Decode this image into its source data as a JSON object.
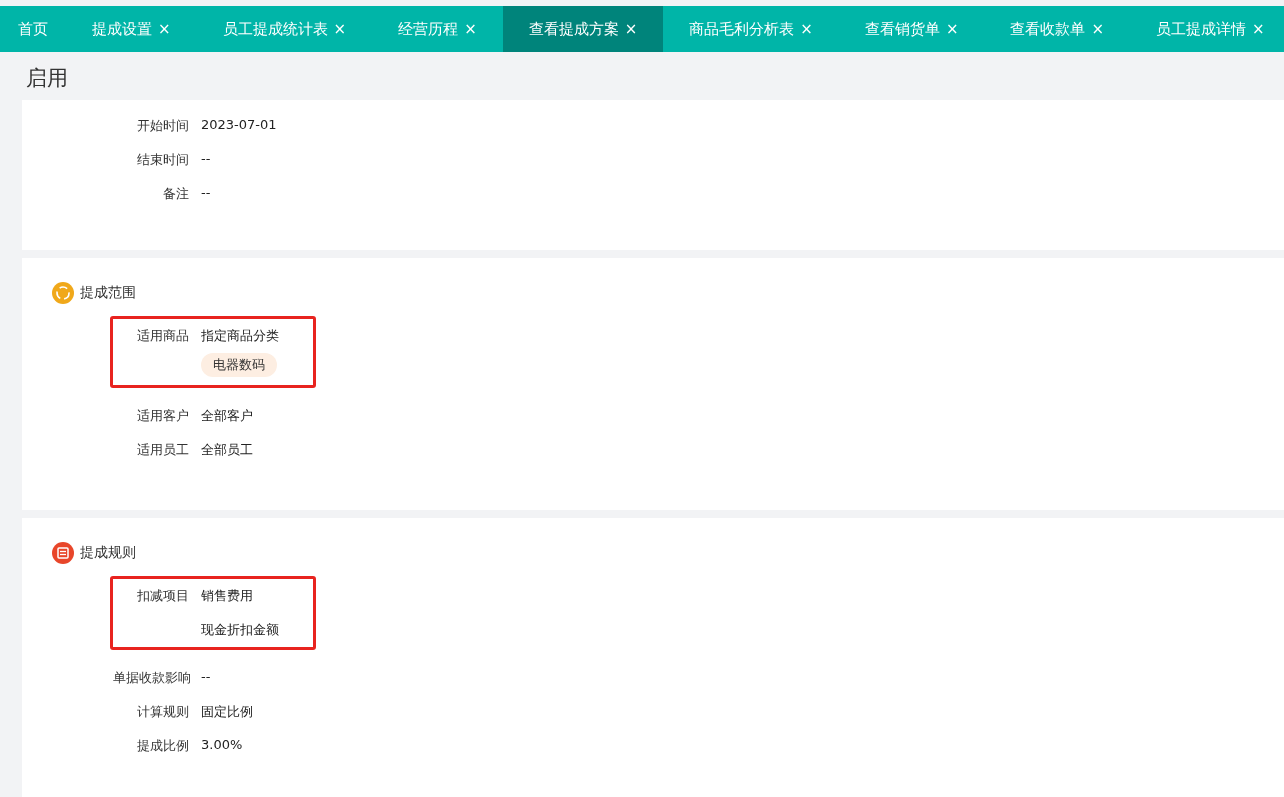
{
  "tabs": [
    {
      "label": "首页",
      "selected": false
    },
    {
      "label": "提成设置",
      "close": "×",
      "selected": false
    },
    {
      "label": "员工提成统计表",
      "close": "×",
      "selected": false
    },
    {
      "label": "经营历程",
      "close": "×",
      "selected": false
    },
    {
      "label": "查看提成方案",
      "close": "×",
      "selected": true
    },
    {
      "label": "商品毛利分析表",
      "close": "×",
      "selected": false
    },
    {
      "label": "查看销货单",
      "close": "×",
      "selected": false
    },
    {
      "label": "查看收款单",
      "close": "×",
      "selected": false
    },
    {
      "label": "员工提成详情",
      "close": "×",
      "selected": false
    }
  ],
  "status": "启用",
  "sections": [
    {
      "groups": [
        {
          "highlighted": false,
          "fields": [
            {
              "label": "开始时间",
              "values": [
                {
                  "kind": "text",
                  "text": "2023-07-01"
                }
              ]
            },
            {
              "label": "结束时间",
              "values": [
                {
                  "kind": "text",
                  "text": "--"
                }
              ]
            },
            {
              "label": "备注",
              "values": [
                {
                  "kind": "text",
                  "text": "--"
                }
              ]
            }
          ]
        }
      ]
    },
    {
      "title": "提成范围",
      "groups": [
        {
          "highlighted": true,
          "fields": [
            {
              "label": "适用商品",
              "values": [
                {
                  "kind": "text",
                  "text": "指定商品分类"
                },
                {
                  "kind": "tag",
                  "text": "电器数码"
                }
              ]
            }
          ]
        },
        {
          "highlighted": false,
          "fields": [
            {
              "label": "适用客户",
              "values": [
                {
                  "kind": "text",
                  "text": "全部客户"
                }
              ]
            },
            {
              "label": "适用员工",
              "values": [
                {
                  "kind": "text",
                  "text": "全部员工"
                }
              ]
            }
          ]
        }
      ]
    },
    {
      "title": "提成规则",
      "groups": [
        {
          "highlighted": true,
          "fields": [
            {
              "label": "扣减项目",
              "values": [
                {
                  "kind": "text",
                  "text": "销售费用"
                },
                {
                  "kind": "text",
                  "text": "现金折扣金额"
                }
              ]
            }
          ]
        },
        {
          "highlighted": false,
          "fields": [
            {
              "label": "单据收款影响",
              "values": [
                {
                  "kind": "text",
                  "text": "--"
                }
              ]
            },
            {
              "label": "计算规则",
              "values": [
                {
                  "kind": "text",
                  "text": "固定比例"
                }
              ]
            },
            {
              "label": "提成比例",
              "values": [
                {
                  "kind": "text",
                  "text": "3.00%"
                }
              ]
            }
          ]
        }
      ]
    }
  ]
}
